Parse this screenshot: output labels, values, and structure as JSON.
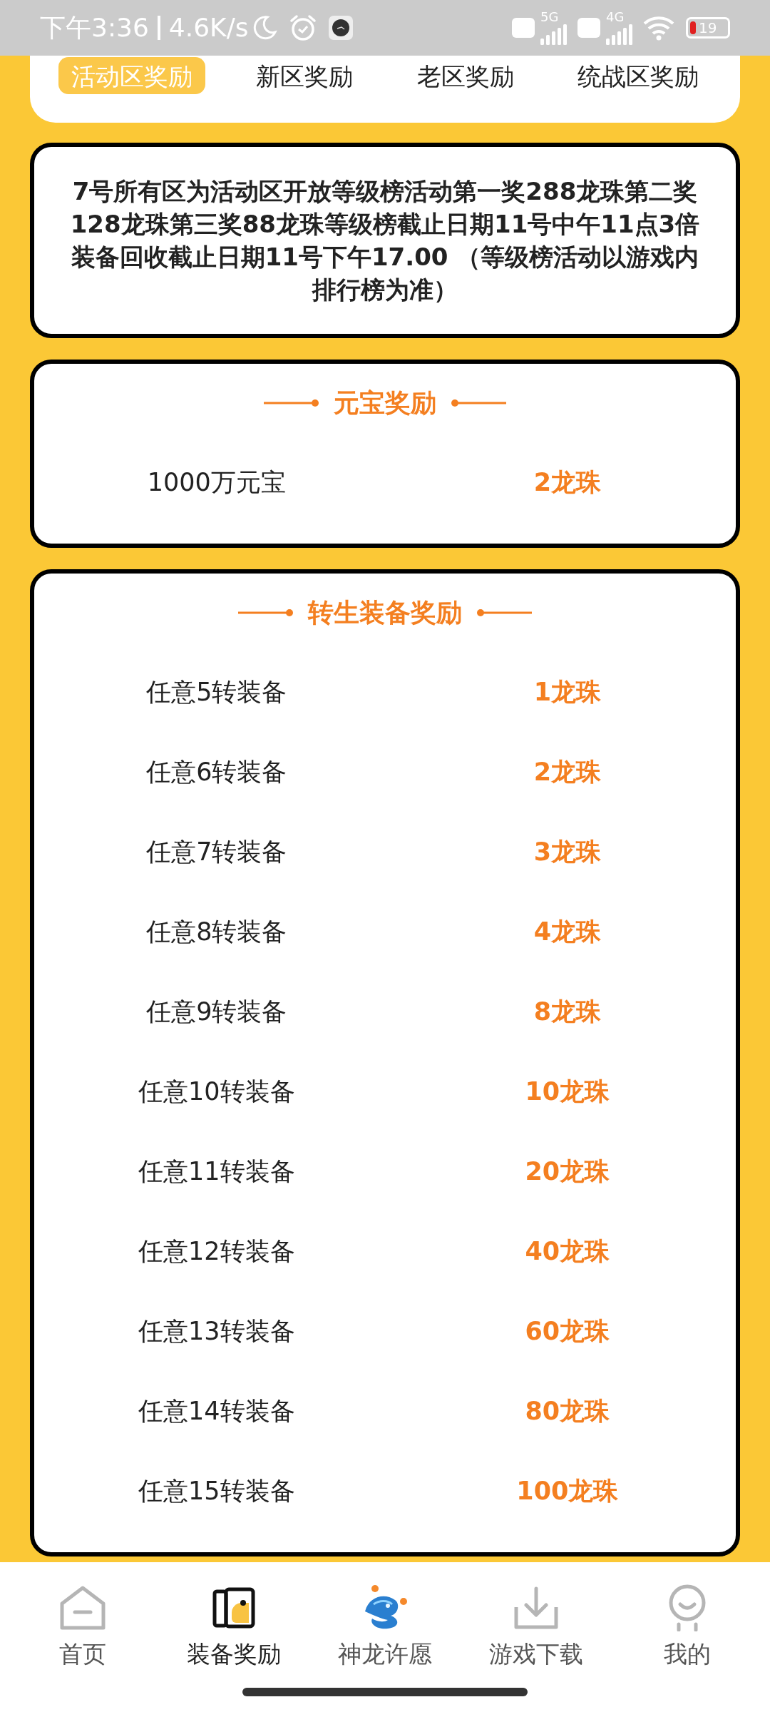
{
  "status_bar": {
    "time": "下午3:36",
    "speed": "4.6K/s",
    "network_1": "5G",
    "network_2": "4G",
    "battery": "19"
  },
  "tabs": [
    {
      "label": "活动区奖励",
      "selected": true
    },
    {
      "label": "新区奖励",
      "selected": false
    },
    {
      "label": "老区奖励",
      "selected": false
    },
    {
      "label": "统战区奖励",
      "selected": false
    }
  ],
  "notice": "7号所有区为活动区开放等级榜活动第一奖288龙珠第二奖128龙珠第三奖88龙珠等级榜截止日期11号中午11点3倍装备回收截止日期11号下午17.00 （等级榜活动以游戏内排行榜为准）",
  "sections": [
    {
      "title": "元宝奖励",
      "rows": [
        {
          "item": "1000万元宝",
          "reward": "2龙珠"
        }
      ]
    },
    {
      "title": "转生装备奖励",
      "rows": [
        {
          "item": "任意5转装备",
          "reward": "1龙珠"
        },
        {
          "item": "任意6转装备",
          "reward": "2龙珠"
        },
        {
          "item": "任意7转装备",
          "reward": "3龙珠"
        },
        {
          "item": "任意8转装备",
          "reward": "4龙珠"
        },
        {
          "item": "任意9转装备",
          "reward": "8龙珠"
        },
        {
          "item": "任意10转装备",
          "reward": "10龙珠"
        },
        {
          "item": "任意11转装备",
          "reward": "20龙珠"
        },
        {
          "item": "任意12转装备",
          "reward": "40龙珠"
        },
        {
          "item": "任意13转装备",
          "reward": "60龙珠"
        },
        {
          "item": "任意14转装备",
          "reward": "80龙珠"
        },
        {
          "item": "任意15转装备",
          "reward": "100龙珠"
        }
      ]
    }
  ],
  "bottom_nav": [
    {
      "kind": "home",
      "label": "首页",
      "selected": false
    },
    {
      "kind": "equipment",
      "label": "装备奖励",
      "selected": true
    },
    {
      "kind": "dragon",
      "label": "神龙许愿",
      "selected": false
    },
    {
      "kind": "download",
      "label": "游戏下载",
      "selected": false
    },
    {
      "kind": "profile",
      "label": "我的",
      "selected": false
    }
  ]
}
